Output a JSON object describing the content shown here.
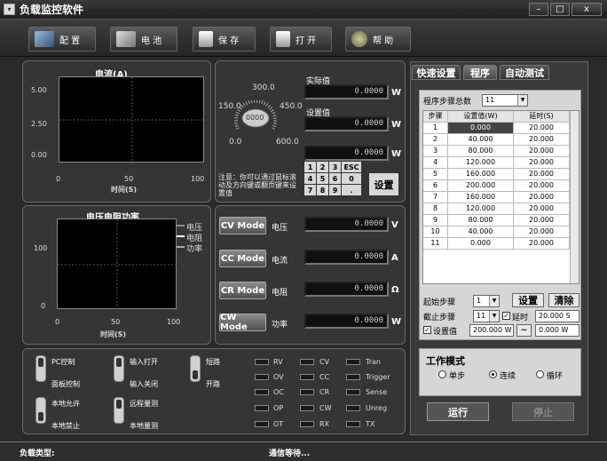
{
  "window": {
    "title": "负载监控软件"
  },
  "toolbar": {
    "config": "配 置",
    "battery": "电 池",
    "save": "保 存",
    "open": "打 开",
    "help": "帮 助"
  },
  "chart_data": [
    {
      "type": "line",
      "title": "电流(A)",
      "xlabel": "时间(S)",
      "ylabel": "",
      "xlim": [
        0,
        100
      ],
      "ylim": [
        0,
        5
      ],
      "xticks": [
        "0",
        "50",
        "100"
      ],
      "yticks": [
        "5.00",
        "2.50",
        "0.00"
      ],
      "series": []
    },
    {
      "type": "line",
      "title": "电压电阻功率",
      "xlabel": "时间(S)",
      "ylabel": "",
      "xlim": [
        0,
        100
      ],
      "ylim": [
        0,
        100
      ],
      "xticks": [
        "0",
        "50",
        "100"
      ],
      "yticks": [
        "100",
        "0"
      ],
      "series": [
        {
          "name": "电压",
          "values": []
        },
        {
          "name": "电阻",
          "values": []
        },
        {
          "name": "功率",
          "values": []
        }
      ]
    }
  ],
  "knob": {
    "ticks": [
      "300.0",
      "150.0",
      "450.0",
      "0.0",
      "600.0"
    ],
    "center": "0000",
    "level": 0
  },
  "readouts": {
    "actual_label": "实际值",
    "actual": "0.0000",
    "set_label": "设置值",
    "set": "0.0000",
    "entry": "0.0000",
    "unit": "W"
  },
  "keypad": {
    "keys": [
      "1",
      "2",
      "3",
      "ESC",
      "4",
      "5",
      "6",
      "0",
      "7",
      "8",
      "9",
      "."
    ],
    "set": "设置"
  },
  "note": "注意：你可以通过鼠标滚动及方向键或翻页键来设置值",
  "modes": [
    {
      "btn": "CV Mode",
      "label": "电压",
      "value": "0.0000",
      "unit": "V"
    },
    {
      "btn": "CC Mode",
      "label": "电流",
      "value": "0.0000",
      "unit": "A"
    },
    {
      "btn": "CR Mode",
      "label": "电阻",
      "value": "0.0000",
      "unit": "Ω"
    },
    {
      "btn": "CW Mode",
      "label": "功率",
      "value": "0.0000",
      "unit": "W"
    }
  ],
  "switches": {
    "pc_control": "PC控制",
    "panel_control": "面板控制",
    "input_on": "输入打开",
    "input_off": "输入关闭",
    "short": "短路",
    "open": "开路",
    "local_allow": "本地允许",
    "local_forbid": "本地禁止",
    "remote_measure": "远程量测",
    "local_measure": "本地量测"
  },
  "leds": [
    [
      "RV",
      "CV",
      "Tran"
    ],
    [
      "OV",
      "CC",
      "Trigger"
    ],
    [
      "OC",
      "CR",
      "Sense"
    ],
    [
      "OP",
      "CW",
      "Unreg"
    ],
    [
      "OT",
      "RX",
      "TX"
    ]
  ],
  "tabs": [
    "快速设置",
    "程序",
    "自动测试"
  ],
  "program": {
    "total_label": "程序步骤总数",
    "total": "11",
    "headers": [
      "步骤",
      "设置值(W)",
      "延时(S)"
    ],
    "rows": [
      [
        "1",
        "0.000",
        "20.000"
      ],
      [
        "2",
        "40.000",
        "20.000"
      ],
      [
        "3",
        "80.000",
        "20.000"
      ],
      [
        "4",
        "120.000",
        "20.000"
      ],
      [
        "5",
        "160.000",
        "20.000"
      ],
      [
        "6",
        "200.000",
        "20.000"
      ],
      [
        "7",
        "160.000",
        "20.000"
      ],
      [
        "8",
        "120.000",
        "20.000"
      ],
      [
        "9",
        "80.000",
        "20.000"
      ],
      [
        "10",
        "40.000",
        "20.000"
      ],
      [
        "11",
        "0.000",
        "20.000"
      ]
    ],
    "start_label": "起始步骤",
    "start": "1",
    "end_label": "截止步骤",
    "end": "11",
    "set_btn": "设置",
    "clear_btn": "清除",
    "delay_label": "延时",
    "delay": "20.000 S",
    "setvalue_label": "设置值",
    "setvalue": "200.000 W",
    "tilde": "~",
    "setvalue2": "0.000 W"
  },
  "work_mode": {
    "title": "工作模式",
    "single": "单步",
    "continuous": "连续",
    "loop": "循环"
  },
  "run": {
    "run": "运行",
    "stop": "停止"
  },
  "status": {
    "load_type": "负载类型:",
    "comm": "通信等待..."
  }
}
